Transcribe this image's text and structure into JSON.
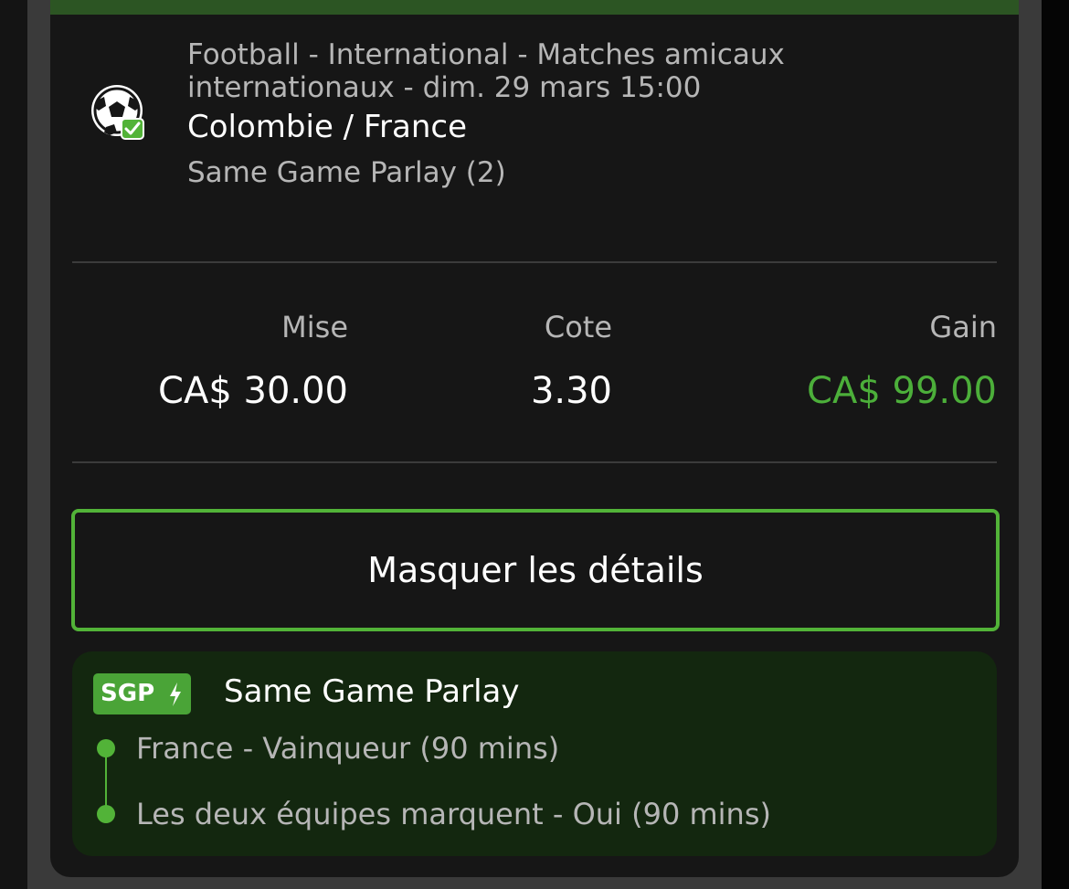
{
  "event": {
    "breadcrumb_line1": "Football - International - Matches amicaux",
    "breadcrumb_line2": "internationaux - dim. 29 mars 15:00",
    "match": "Colombie / France",
    "bet_type": "Same Game Parlay (2)",
    "sport_icon": "soccer-ball-check-icon"
  },
  "stats": {
    "stake_label": "Mise",
    "stake_value": "CA$ 30.00",
    "odds_label": "Cote",
    "odds_value": "3.30",
    "payout_label": "Gain",
    "payout_value": "CA$ 99.00"
  },
  "actions": {
    "hide_details": "Masquer les détails"
  },
  "parlay": {
    "badge": "SGP",
    "badge_icon": "lightning-bolt-icon",
    "title": "Same Game Parlay",
    "legs": [
      {
        "label": "France - Vainqueur (90 mins)"
      },
      {
        "label": "Les deux équipes marquent - Oui (90 mins)"
      }
    ]
  },
  "colors": {
    "accent_green": "#52b338",
    "payout_green": "#4caf3a",
    "card_background": "#161616",
    "panel_background": "#13270f"
  }
}
